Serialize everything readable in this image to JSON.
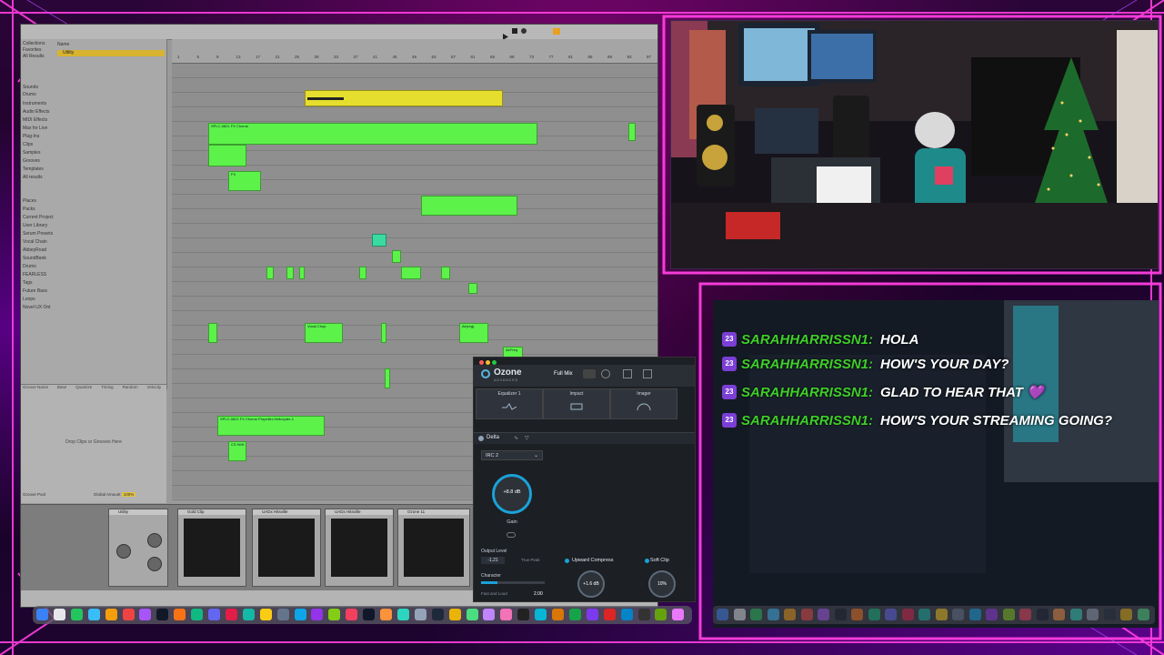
{
  "browser": {
    "header": "Name",
    "selected_item": "Utility",
    "categories": [
      "Collections",
      "Favorites",
      "All Results",
      "Sounds",
      "Drums",
      "Instruments",
      "Audio Effects",
      "MIDI Effects",
      "Max for Live",
      "Plug-Ins",
      "Clips",
      "Samples",
      "Grooves",
      "Templates",
      "All results",
      "Places",
      "Packs",
      "Current Project",
      "User Library",
      "Serum Presets",
      "Vocal Chain",
      "AbbeyRoad",
      "SoundBank",
      "Drums",
      "FEARLESS",
      "Tags",
      "Future Bass",
      "Loops",
      "Novel UX Ont"
    ]
  },
  "groove_pool": {
    "columns": [
      "Groove Name",
      "Base",
      "Quantize",
      "Timing",
      "Random",
      "Velocity"
    ],
    "drop_text": "Drop Clips or Grooves Here",
    "global_amount_label": "Global Amount",
    "global_amount_value": "100%",
    "footer": "Groove Pool"
  },
  "ruler": {
    "ticks": [
      "1",
      "5",
      "9",
      "13",
      "17",
      "21",
      "25",
      "29",
      "33",
      "37",
      "41",
      "45",
      "49",
      "53",
      "57",
      "61",
      "65",
      "69",
      "73",
      "77",
      "81",
      "85",
      "89",
      "93",
      "97"
    ]
  },
  "clips": {
    "c1": "SPLC-0821 FX Chorus",
    "c2": "FX",
    "c3": "KK_Gro",
    "c4": "Vocal Chop",
    "c5": "SPLC-0821_FX_Chorus",
    "c6": "FX",
    "c7": "Air(reg)",
    "c8": "AirFreq",
    "c9": "SPLC-0821 FX Chorus Propeller-Helicopter-1",
    "c10": "CS HiHt"
  },
  "devices": [
    {
      "title": "Utility"
    },
    {
      "title": "Gold Clip"
    },
    {
      "title": "UADx Hitsville"
    },
    {
      "title": "UADx Hitsville"
    },
    {
      "title": "Ozone 11"
    }
  ],
  "ozone": {
    "logo": "Ozone",
    "edition": "ADVANCED",
    "full_mix": "Full Mix",
    "modules": [
      "Equalizer 1",
      "Impact",
      "Imager"
    ],
    "delta": "Delta",
    "irc": "IRC 2",
    "gain_value": "+8.8 dB",
    "gain_label": "Gain",
    "output_level_label": "Output Level",
    "output_level_value": "-1.21",
    "true_peak": "True Peak",
    "character_label": "Character",
    "fast_label": "Fast and Loud",
    "character_value": "2.00",
    "upward_compress": "Upward Compress",
    "upward_value": "+1.6 dB",
    "soft_clip": "Soft Clip",
    "soft_clip_value": "10%"
  },
  "chat": [
    {
      "user": "SARAHHARRISSN1:",
      "message": "HOLA",
      "badge": "23"
    },
    {
      "user": "SARAHHARRISSN1:",
      "message": "HOW'S YOUR DAY?",
      "badge": "23"
    },
    {
      "user": "SARAHHARRISSN1:",
      "message": "GLAD TO HEAR THAT",
      "badge": "23",
      "emote": "💜"
    },
    {
      "user": "SARAHHARRISSN1:",
      "message": "HOW'S YOUR STREAMING GOING?",
      "badge": "23"
    }
  ],
  "colors": {
    "clip_green": "#5cf24a",
    "clip_yellow": "#e6de2f",
    "neon_pink": "#ff3ee0",
    "chat_user": "#3fcf29",
    "ozone_accent": "#1aa2d8"
  }
}
